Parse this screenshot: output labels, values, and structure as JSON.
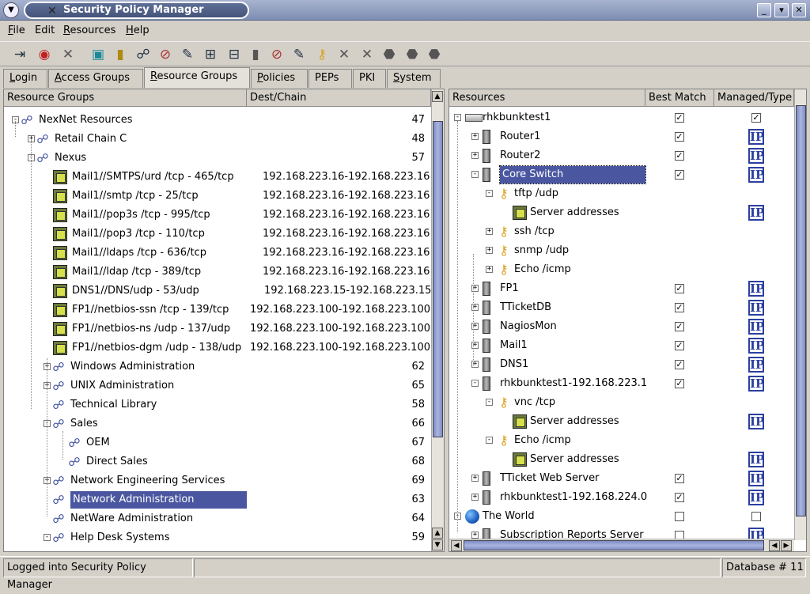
{
  "window": {
    "title": "Security Policy Manager",
    "title_icon": "tools-icon"
  },
  "menu": [
    "File",
    "Edit",
    "Resources",
    "Help"
  ],
  "tabs": [
    "Login",
    "Access Groups",
    "Resource Groups",
    "Policies",
    "PEPs",
    "PKI",
    "System"
  ],
  "active_tab": "Resource Groups",
  "left": {
    "headers": {
      "name": "Resource Groups",
      "dest": "Dest/Chain"
    },
    "rows": [
      {
        "label": "NexNet Resources",
        "num": "47"
      },
      {
        "label": "Retail Chain C",
        "num": "48"
      },
      {
        "label": "Nexus",
        "num": "57"
      },
      {
        "label": "Mail1//SMTPS/urd /tcp - 465/tcp",
        "dest": "192.168.223.16-192.168.223.16"
      },
      {
        "label": "Mail1//smtp /tcp - 25/tcp",
        "dest": "192.168.223.16-192.168.223.16"
      },
      {
        "label": "Mail1//pop3s /tcp - 995/tcp",
        "dest": "192.168.223.16-192.168.223.16"
      },
      {
        "label": "Mail1//pop3 /tcp - 110/tcp",
        "dest": "192.168.223.16-192.168.223.16"
      },
      {
        "label": "Mail1//ldaps /tcp - 636/tcp",
        "dest": "192.168.223.16-192.168.223.16"
      },
      {
        "label": "Mail1//ldap /tcp - 389/tcp",
        "dest": "192.168.223.16-192.168.223.16"
      },
      {
        "label": "DNS1//DNS/udp - 53/udp",
        "dest": "192.168.223.15-192.168.223.15"
      },
      {
        "label": "FP1//netbios-ssn /tcp - 139/tcp",
        "dest": "192.168.223.100-192.168.223.100"
      },
      {
        "label": "FP1//netbios-ns /udp - 137/udp",
        "dest": "192.168.223.100-192.168.223.100"
      },
      {
        "label": "FP1//netbios-dgm /udp - 138/udp",
        "dest": "192.168.223.100-192.168.223.100"
      },
      {
        "label": "Windows Administration",
        "num": "62"
      },
      {
        "label": "UNIX Administration",
        "num": "65"
      },
      {
        "label": "Technical Library",
        "num": "58"
      },
      {
        "label": "Sales",
        "num": "66"
      },
      {
        "label": "OEM",
        "num": "67"
      },
      {
        "label": "Direct Sales",
        "num": "68"
      },
      {
        "label": "Network Engineering Services",
        "num": "69"
      },
      {
        "label": "Network Administration",
        "num": "63"
      },
      {
        "label": "NetWare Administration",
        "num": "64"
      },
      {
        "label": "Help Desk Systems",
        "num": "59"
      }
    ]
  },
  "right": {
    "headers": {
      "name": "Resources",
      "best": "Best Match",
      "managed": "Managed/Type"
    },
    "ip_label": "IP",
    "check_mark": "✓",
    "rows": [
      {
        "label": "rhkbunktest1"
      },
      {
        "label": "Router1"
      },
      {
        "label": "Router2"
      },
      {
        "label": "Core Switch"
      },
      {
        "label": "tftp /udp"
      },
      {
        "label": "Server addresses"
      },
      {
        "label": "ssh /tcp"
      },
      {
        "label": "snmp /udp"
      },
      {
        "label": "Echo /icmp"
      },
      {
        "label": "FP1"
      },
      {
        "label": "TTicketDB"
      },
      {
        "label": "NagiosMon"
      },
      {
        "label": "Mail1"
      },
      {
        "label": "DNS1"
      },
      {
        "label": "rhkbunktest1-192.168.223.1"
      },
      {
        "label": "vnc /tcp"
      },
      {
        "label": "Server addresses"
      },
      {
        "label": "Echo /icmp"
      },
      {
        "label": "Server addresses"
      },
      {
        "label": "TTicket Web Server"
      },
      {
        "label": "rhkbunktest1-192.168.224.0"
      },
      {
        "label": "The World"
      },
      {
        "label": "Subscription Reports Server"
      }
    ]
  },
  "status": {
    "message": "Logged into Security Policy Manager",
    "database": "Database # 11"
  }
}
